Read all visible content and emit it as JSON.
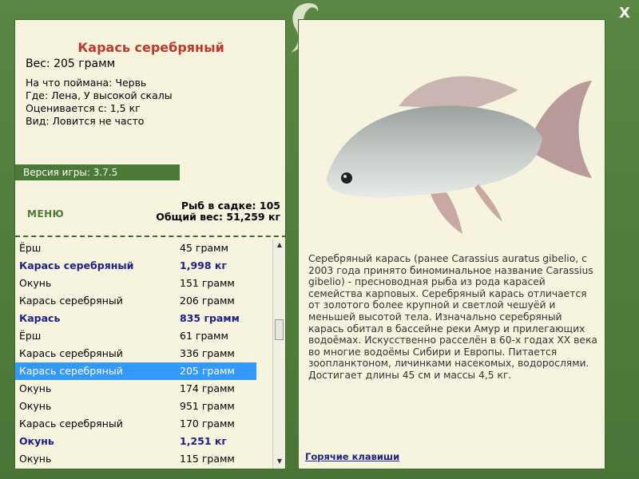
{
  "fish": {
    "name": "Карась серебряный",
    "weight": "Вес: 205 грамм",
    "details": [
      "На что поймана: Червь",
      "Где: Лена, У высокой скалы",
      "Оценивается с: 1,5 кг",
      "Вид: Ловится не часто"
    ]
  },
  "version": "Версия игры: 3.7.5",
  "menu_label": "МЕНЮ",
  "stats": {
    "count": "Рыб в садке: 105",
    "total": "Общий вес: 51,259 кг"
  },
  "catch_list": [
    {
      "name": "Ёрш",
      "weight": "45 грамм",
      "bold": false,
      "selected": false
    },
    {
      "name": "Карась серебряный",
      "weight": "1,998 кг",
      "bold": true,
      "selected": false
    },
    {
      "name": "Окунь",
      "weight": "151 грамм",
      "bold": false,
      "selected": false
    },
    {
      "name": "Карась серебряный",
      "weight": "206 грамм",
      "bold": false,
      "selected": false
    },
    {
      "name": "Карась",
      "weight": "835 грамм",
      "bold": true,
      "selected": false
    },
    {
      "name": "Ёрш",
      "weight": "61 грамм",
      "bold": false,
      "selected": false
    },
    {
      "name": "Карась серебряный",
      "weight": "336 грамм",
      "bold": false,
      "selected": false
    },
    {
      "name": "Карась серебряный",
      "weight": "205 грамм",
      "bold": false,
      "selected": true
    },
    {
      "name": "Окунь",
      "weight": "174 грамм",
      "bold": false,
      "selected": false
    },
    {
      "name": "Окунь",
      "weight": "951 грамм",
      "bold": false,
      "selected": false
    },
    {
      "name": "Карась серебряный",
      "weight": "170 грамм",
      "bold": false,
      "selected": false
    },
    {
      "name": "Окунь",
      "weight": "1,251 кг",
      "bold": true,
      "selected": false
    },
    {
      "name": "Окунь",
      "weight": "115 грамм",
      "bold": false,
      "selected": false
    }
  ],
  "description": "Серебряный карась (ранее Carassius auratus gibelio, с 2003 года принято биноминальное название Carassius gibelio) - пресноводная рыба из рода карасей семейства карповых. Серебряный карась отличается от золотого более крупной и светлой чешуёй и меньшей высотой тела. Изначально серебряный карась обитал в бассейне реки Амур и прилегающих водоёмах. Искусственно расселён в 60-х годах XX века во многие водоёмы Сибири и Европы. Питается зоопланктоном, личинками насекомых, водорослями. Достигает длины 45 см и массы 4,5 кг.",
  "hotkeys_label": "Горячие клавиши",
  "close_label": "X",
  "colors": {
    "frame_green": "#4c7a3a",
    "panel_bg": "#f6f4df",
    "title_red": "#c0392b",
    "bold_blue": "#1f1f8a",
    "selection": "#3399ff"
  },
  "icons": [
    "close-icon",
    "logo-icon",
    "scroll-up-icon",
    "scroll-down-icon"
  ]
}
